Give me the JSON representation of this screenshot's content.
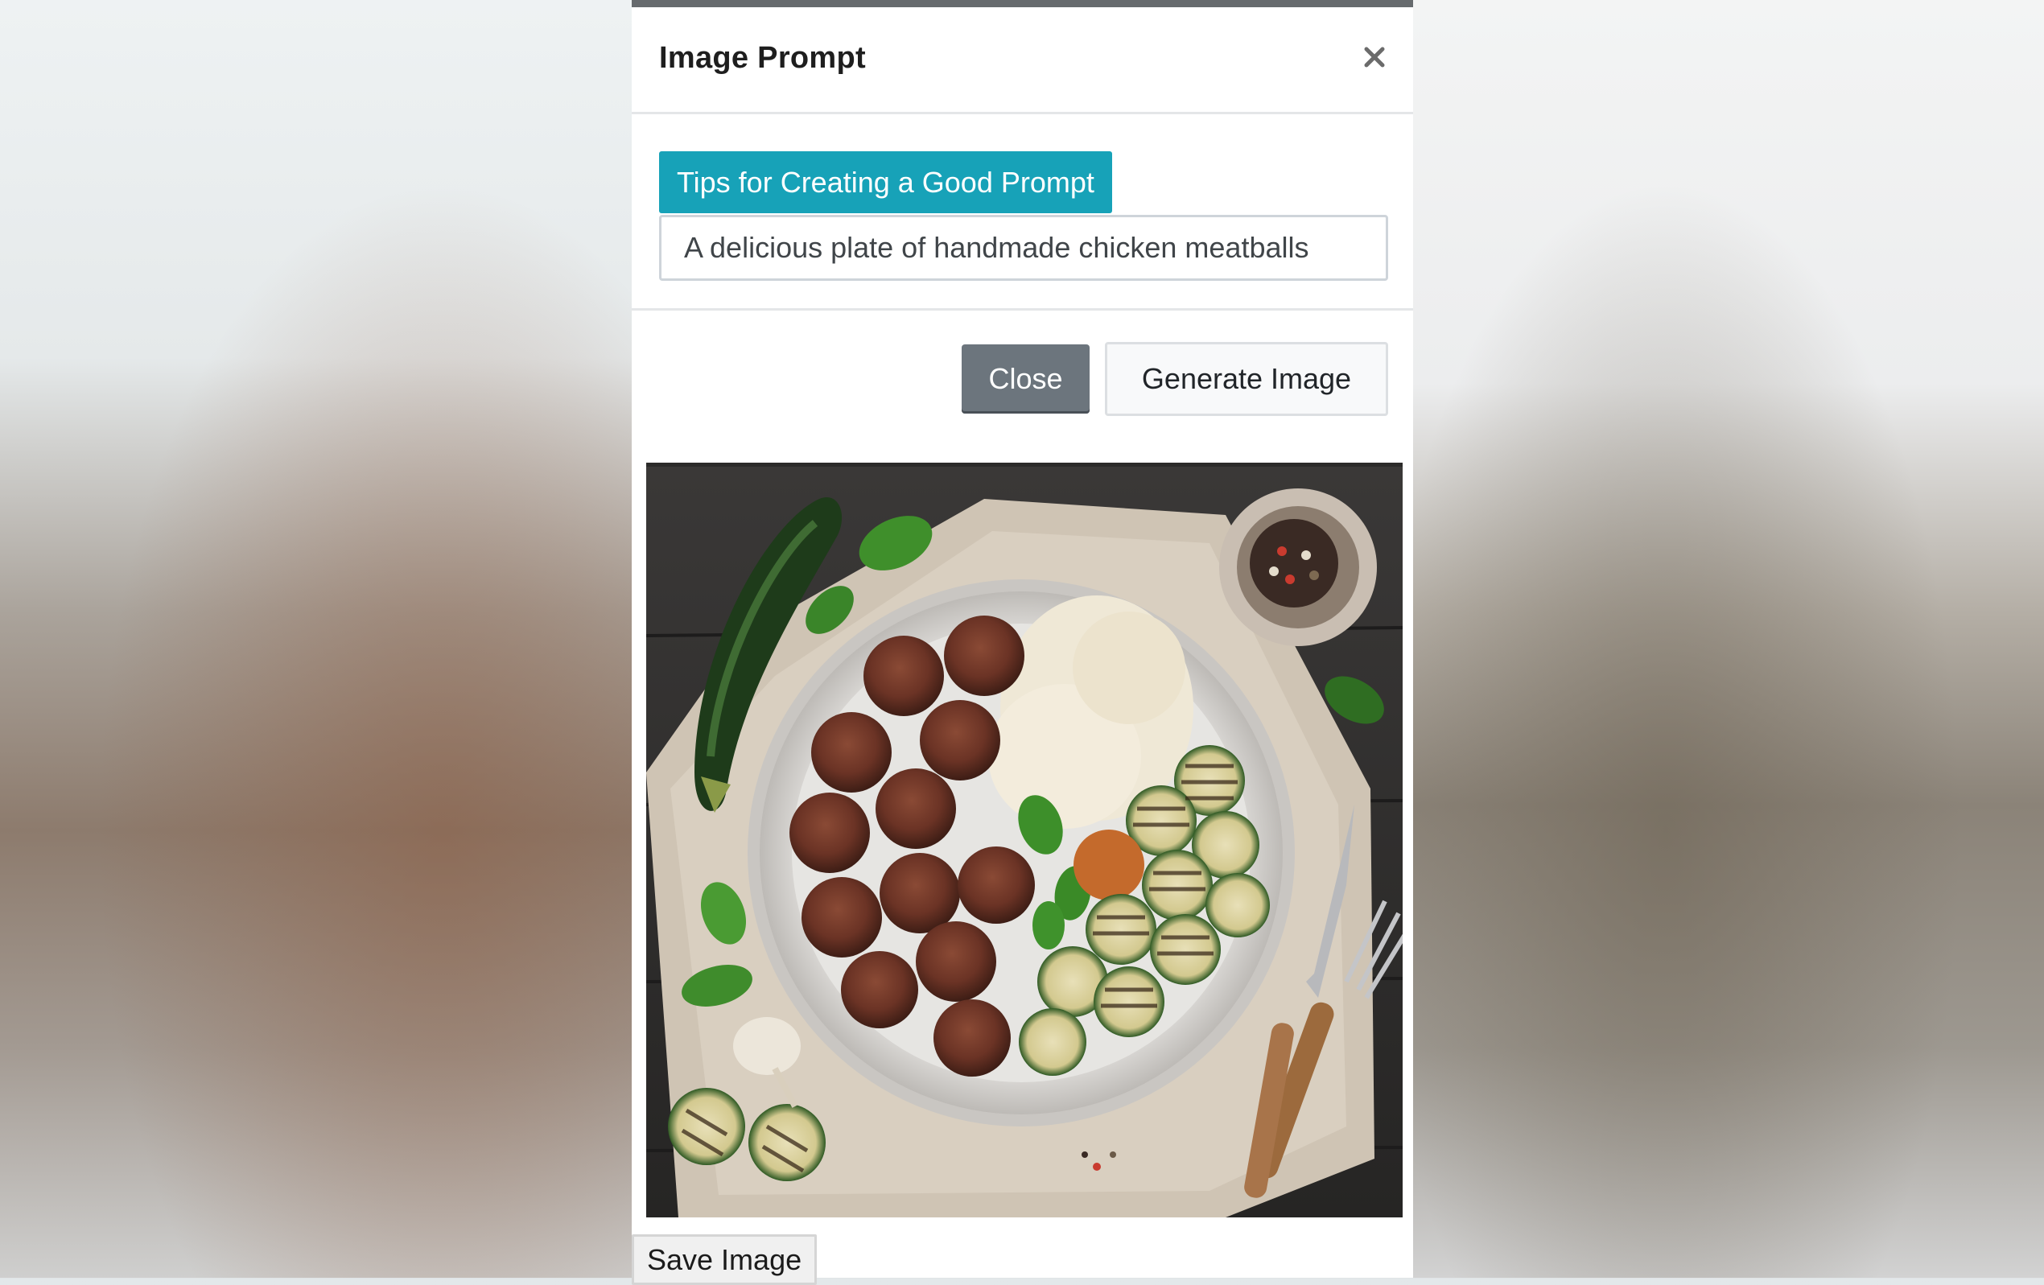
{
  "modal": {
    "title": "Image Prompt",
    "tips_button": "Tips for Creating a Good Prompt",
    "prompt_value": "A delicious plate of handmade chicken meatballs",
    "close_button": "Close",
    "generate_button": "Generate Image",
    "save_button": "Save Image"
  },
  "colors": {
    "accent": "#17a2b8",
    "secondary": "#6c757d",
    "header_bar": "#666a6d"
  },
  "icons": {
    "close": "close-icon"
  }
}
